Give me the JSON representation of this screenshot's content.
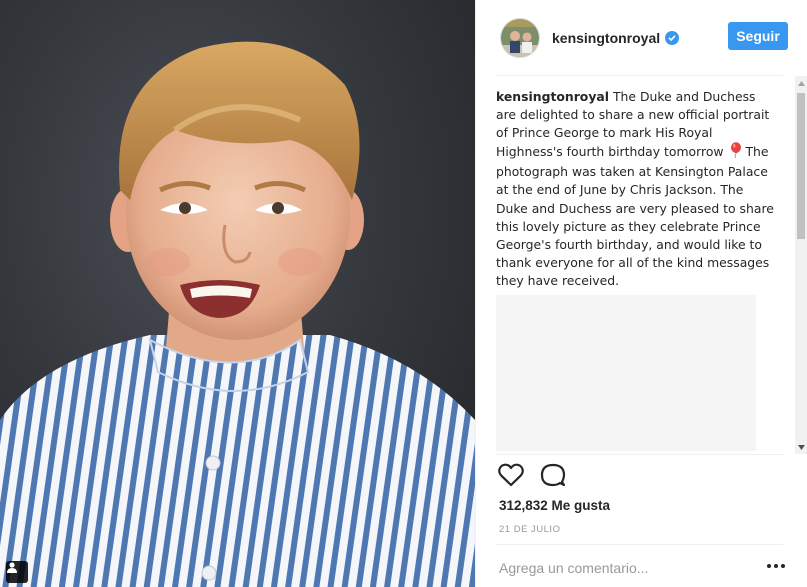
{
  "post": {
    "username": "kensingtonroyal",
    "follow_label": "Seguir",
    "caption_user": "kensingtonroyal",
    "caption_part1": "The Duke and Duchess are delighted to share a new official portrait of Prince George to mark His Royal Highness's fourth birthday tomorrow",
    "caption_part2": "The photograph was taken at Kensington Palace at the end of June by Chris Jackson. The Duke and Duchess are very pleased to share this lovely picture as they celebrate Prince George's fourth birthday, and would like to thank everyone for all of the kind messages they have received.",
    "likes": "312,832 Me gusta",
    "date": "21 DE JULIO",
    "comment_placeholder": "Agrega un comentario..."
  },
  "icons": {
    "verified": "verified-badge-icon",
    "like": "heart-icon",
    "comment": "comment-bubble-icon",
    "more": "more-options-icon",
    "user_tag": "user-tag-icon",
    "caption_emoji": "balloon-emoji-icon"
  },
  "colors": {
    "accent": "#3897f0",
    "text": "#262626",
    "muted": "#999999",
    "divider": "#efefef"
  }
}
